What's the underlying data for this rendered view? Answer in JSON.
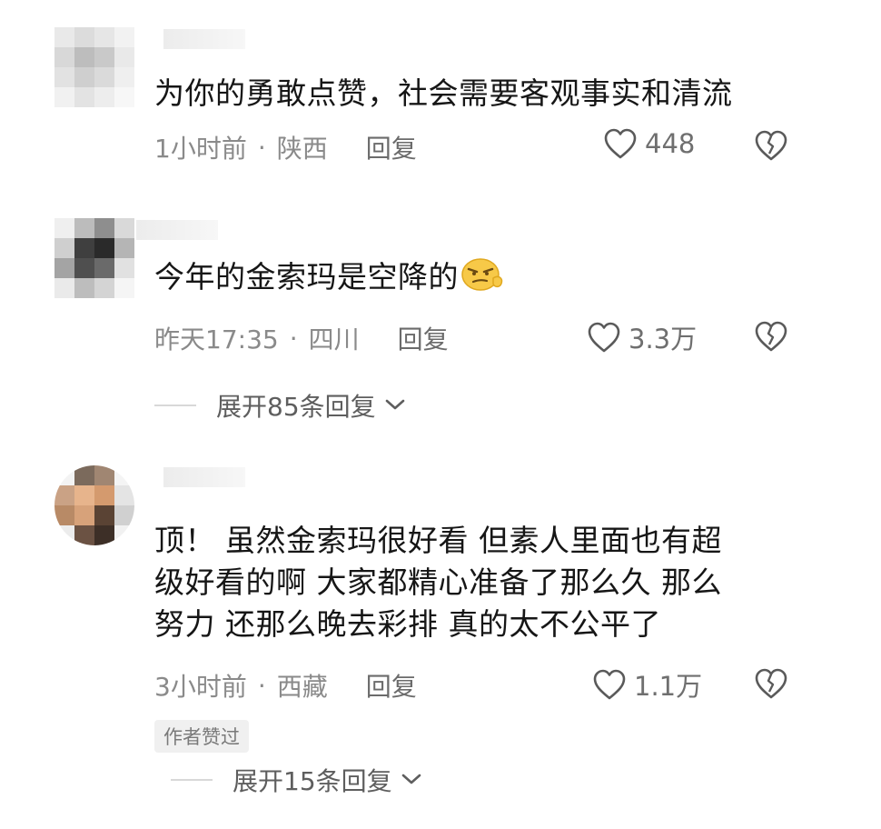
{
  "comments": [
    {
      "text": "为你的勇敢点赞，社会需要客观事实和清流",
      "time": "1小时前",
      "dot": "·",
      "region": "陕西",
      "reply": "回复",
      "likes": "448"
    },
    {
      "text": "今年的金索玛是空降的",
      "emoji": "smirk-emoji",
      "time": "昨天17:35",
      "dot": "·",
      "region": "四川",
      "reply": "回复",
      "likes": "3.3万",
      "expand": "展开85条回复"
    },
    {
      "text_lines": [
        "顶！ 虽然金索玛很好看 但素人里面也有超",
        "级好看的啊 大家都精心准备了那么久 那么",
        "努力 还那么晚去彩排 真的太不公平了"
      ],
      "time": "3小时前",
      "dot": "·",
      "region": "西藏",
      "reply": "回复",
      "likes": "1.1万",
      "badge": "作者赞过",
      "expand": "展开15条回复"
    }
  ],
  "icons": {
    "like": "heart-outline-icon",
    "dislike": "broken-heart-icon",
    "expand": "chevron-down-icon"
  },
  "colors": {
    "text": "#161616",
    "meta": "#8a8a8a",
    "badge_bg": "#f0f0f0"
  }
}
